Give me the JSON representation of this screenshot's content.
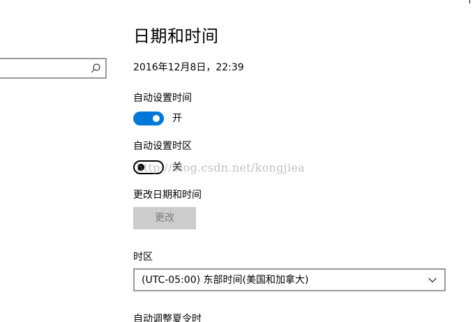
{
  "page": {
    "title": "日期和时间",
    "current_datetime": "2016年12月8日，22:39"
  },
  "search": {
    "value": "",
    "icon": "search-icon"
  },
  "auto_time": {
    "label": "自动设置时间",
    "state": "开",
    "enabled": true,
    "accent_color": "#0078d7"
  },
  "auto_timezone": {
    "label": "自动设置时区",
    "state": "关",
    "enabled": false
  },
  "change_datetime": {
    "label": "更改日期和时间",
    "button_label": "更改",
    "button_disabled": true
  },
  "timezone": {
    "label": "时区",
    "selected": "(UTC-05:00) 东部时间(美国和加拿大)",
    "icon": "chevron-down-icon"
  },
  "dst": {
    "label": "自动调整夏令时"
  },
  "watermark": {
    "text": "http://blog.csdn.net/kongjiea"
  }
}
